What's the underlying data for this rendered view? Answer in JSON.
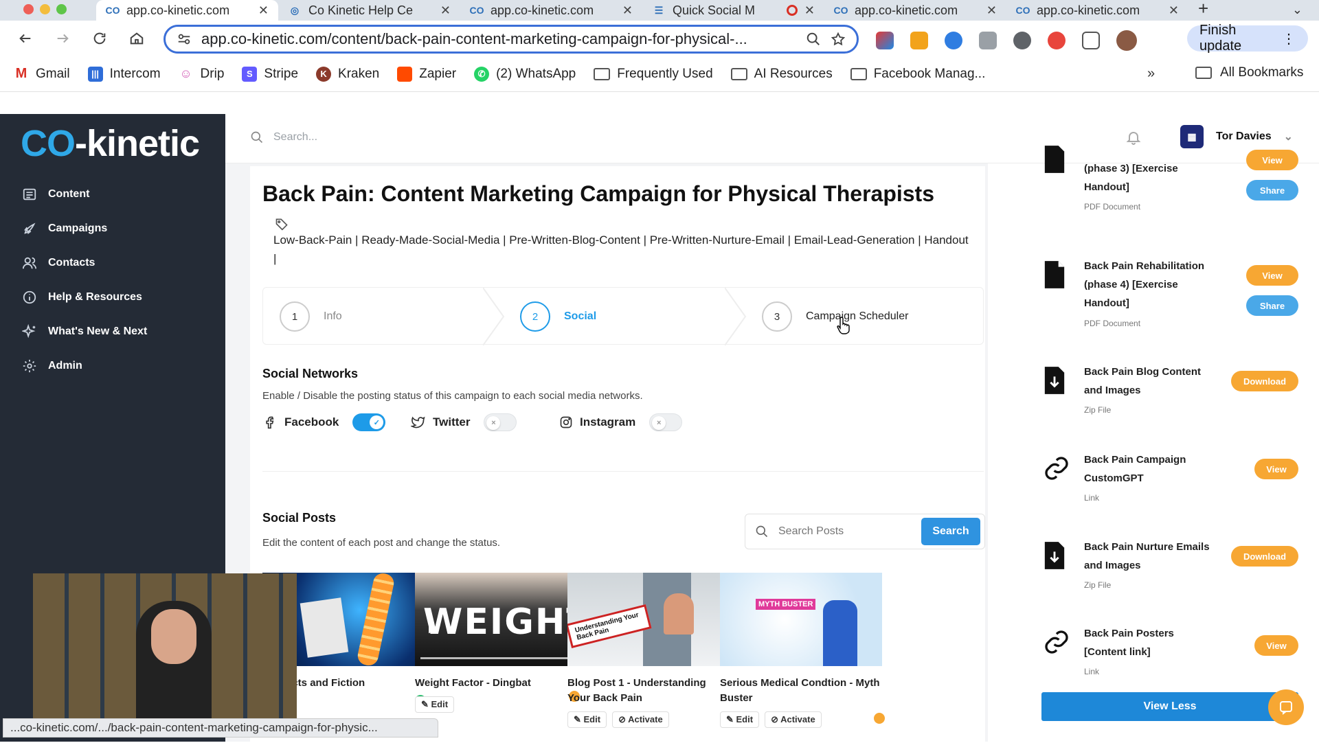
{
  "browser": {
    "tabs": [
      {
        "label": "app.co-kinetic.com",
        "active": true
      },
      {
        "label": "Co Kinetic Help Ce",
        "active": false
      },
      {
        "label": "app.co-kinetic.com",
        "active": false
      },
      {
        "label": "Quick Social M",
        "active": false
      },
      {
        "label": "app.co-kinetic.com",
        "active": false
      },
      {
        "label": "app.co-kinetic.com",
        "active": false
      }
    ],
    "url": "app.co-kinetic.com/content/back-pain-content-marketing-campaign-for-physical-...",
    "finish_update": "Finish update",
    "bookmarks": [
      "Gmail",
      "Intercom",
      "Drip",
      "Stripe",
      "Kraken",
      "Zapier",
      "(2) WhatsApp",
      "Frequently Used",
      "AI Resources",
      "Facebook Manag..."
    ],
    "bookmarks_more": "»",
    "all_bookmarks": "All Bookmarks",
    "status_url": "...co-kinetic.com/.../back-pain-content-marketing-campaign-for-physic..."
  },
  "app": {
    "logo_c": "CO",
    "logo_rest": "-kinetic",
    "nav": [
      {
        "label": "Content",
        "icon": "content-icon"
      },
      {
        "label": "Campaigns",
        "icon": "rocket-icon"
      },
      {
        "label": "Contacts",
        "icon": "contacts-icon"
      },
      {
        "label": "Help & Resources",
        "icon": "info-icon"
      },
      {
        "label": "What's New & Next",
        "icon": "sparkle-icon"
      },
      {
        "label": "Admin",
        "icon": "gear-icon"
      }
    ],
    "search_placeholder": "Search...",
    "user_name": "Tor Davies"
  },
  "page": {
    "title": "Back Pain: Content Marketing Campaign for Physical Therapists",
    "tags": "Low-Back-Pain | Ready-Made-Social-Media | Pre-Written-Blog-Content | Pre-Written-Nurture-Email | Email-Lead-Generation | Handout |",
    "steps": [
      {
        "num": "1",
        "label": "Info"
      },
      {
        "num": "2",
        "label": "Social"
      },
      {
        "num": "3",
        "label": "Campaign Scheduler"
      }
    ],
    "social_networks_title": "Social Networks",
    "social_networks_desc": "Enable / Disable the posting status of this campaign to each social media networks.",
    "networks": [
      {
        "name": "Facebook",
        "enabled": true
      },
      {
        "name": "Twitter",
        "enabled": false
      },
      {
        "name": "Instagram",
        "enabled": false
      }
    ],
    "social_posts_title": "Social Posts",
    "social_posts_desc": "Edit the content of each post and change the status.",
    "search_posts_placeholder": "Search Posts",
    "search_button": "Search",
    "posts": [
      {
        "title": "ain Facts and Fiction",
        "status_color": "#2fbf71"
      },
      {
        "title": "Weight Factor - Dingbat",
        "edit": "Edit",
        "status_color": "#f7a733"
      },
      {
        "title": "Blog Post 1 - Understanding Your Back Pain",
        "edit": "Edit",
        "activate": "Activate",
        "status_color": "#f7a733"
      },
      {
        "title": "Serious Medical Condtion - Myth Buster",
        "edit": "Edit",
        "activate": "Activate",
        "status_color": "#f7a733"
      }
    ],
    "thumb_texts": {
      "weight": "WEIGHT",
      "blog": "Understanding Your Back Pain",
      "myth": "MYTH BUSTER"
    }
  },
  "resources": [
    {
      "name": "(phase 3) [Exercise Handout]",
      "type": "PDF Document",
      "buttons": [
        "View",
        "Share"
      ],
      "icon": "pdf-icon"
    },
    {
      "name": "Back Pain Rehabilitation (phase 4) [Exercise Handout]",
      "type": "PDF Document",
      "buttons": [
        "View",
        "Share"
      ],
      "icon": "pdf-icon"
    },
    {
      "name": "Back Pain Blog Content and Images",
      "type": "Zip File",
      "buttons": [
        "Download"
      ],
      "icon": "download-file-icon"
    },
    {
      "name": "Back Pain Campaign CustomGPT",
      "type": "Link",
      "buttons": [
        "View"
      ],
      "icon": "link-icon"
    },
    {
      "name": "Back Pain Nurture Emails and Images",
      "type": "Zip File",
      "buttons": [
        "Download"
      ],
      "icon": "download-file-icon"
    },
    {
      "name": "Back Pain Posters [Content link]",
      "type": "Link",
      "buttons": [
        "View"
      ],
      "icon": "link-icon"
    }
  ],
  "view_less": "View Less",
  "colors": {
    "accent": "#1e9be8",
    "orange": "#f7a733",
    "sidebar": "#242b36"
  }
}
